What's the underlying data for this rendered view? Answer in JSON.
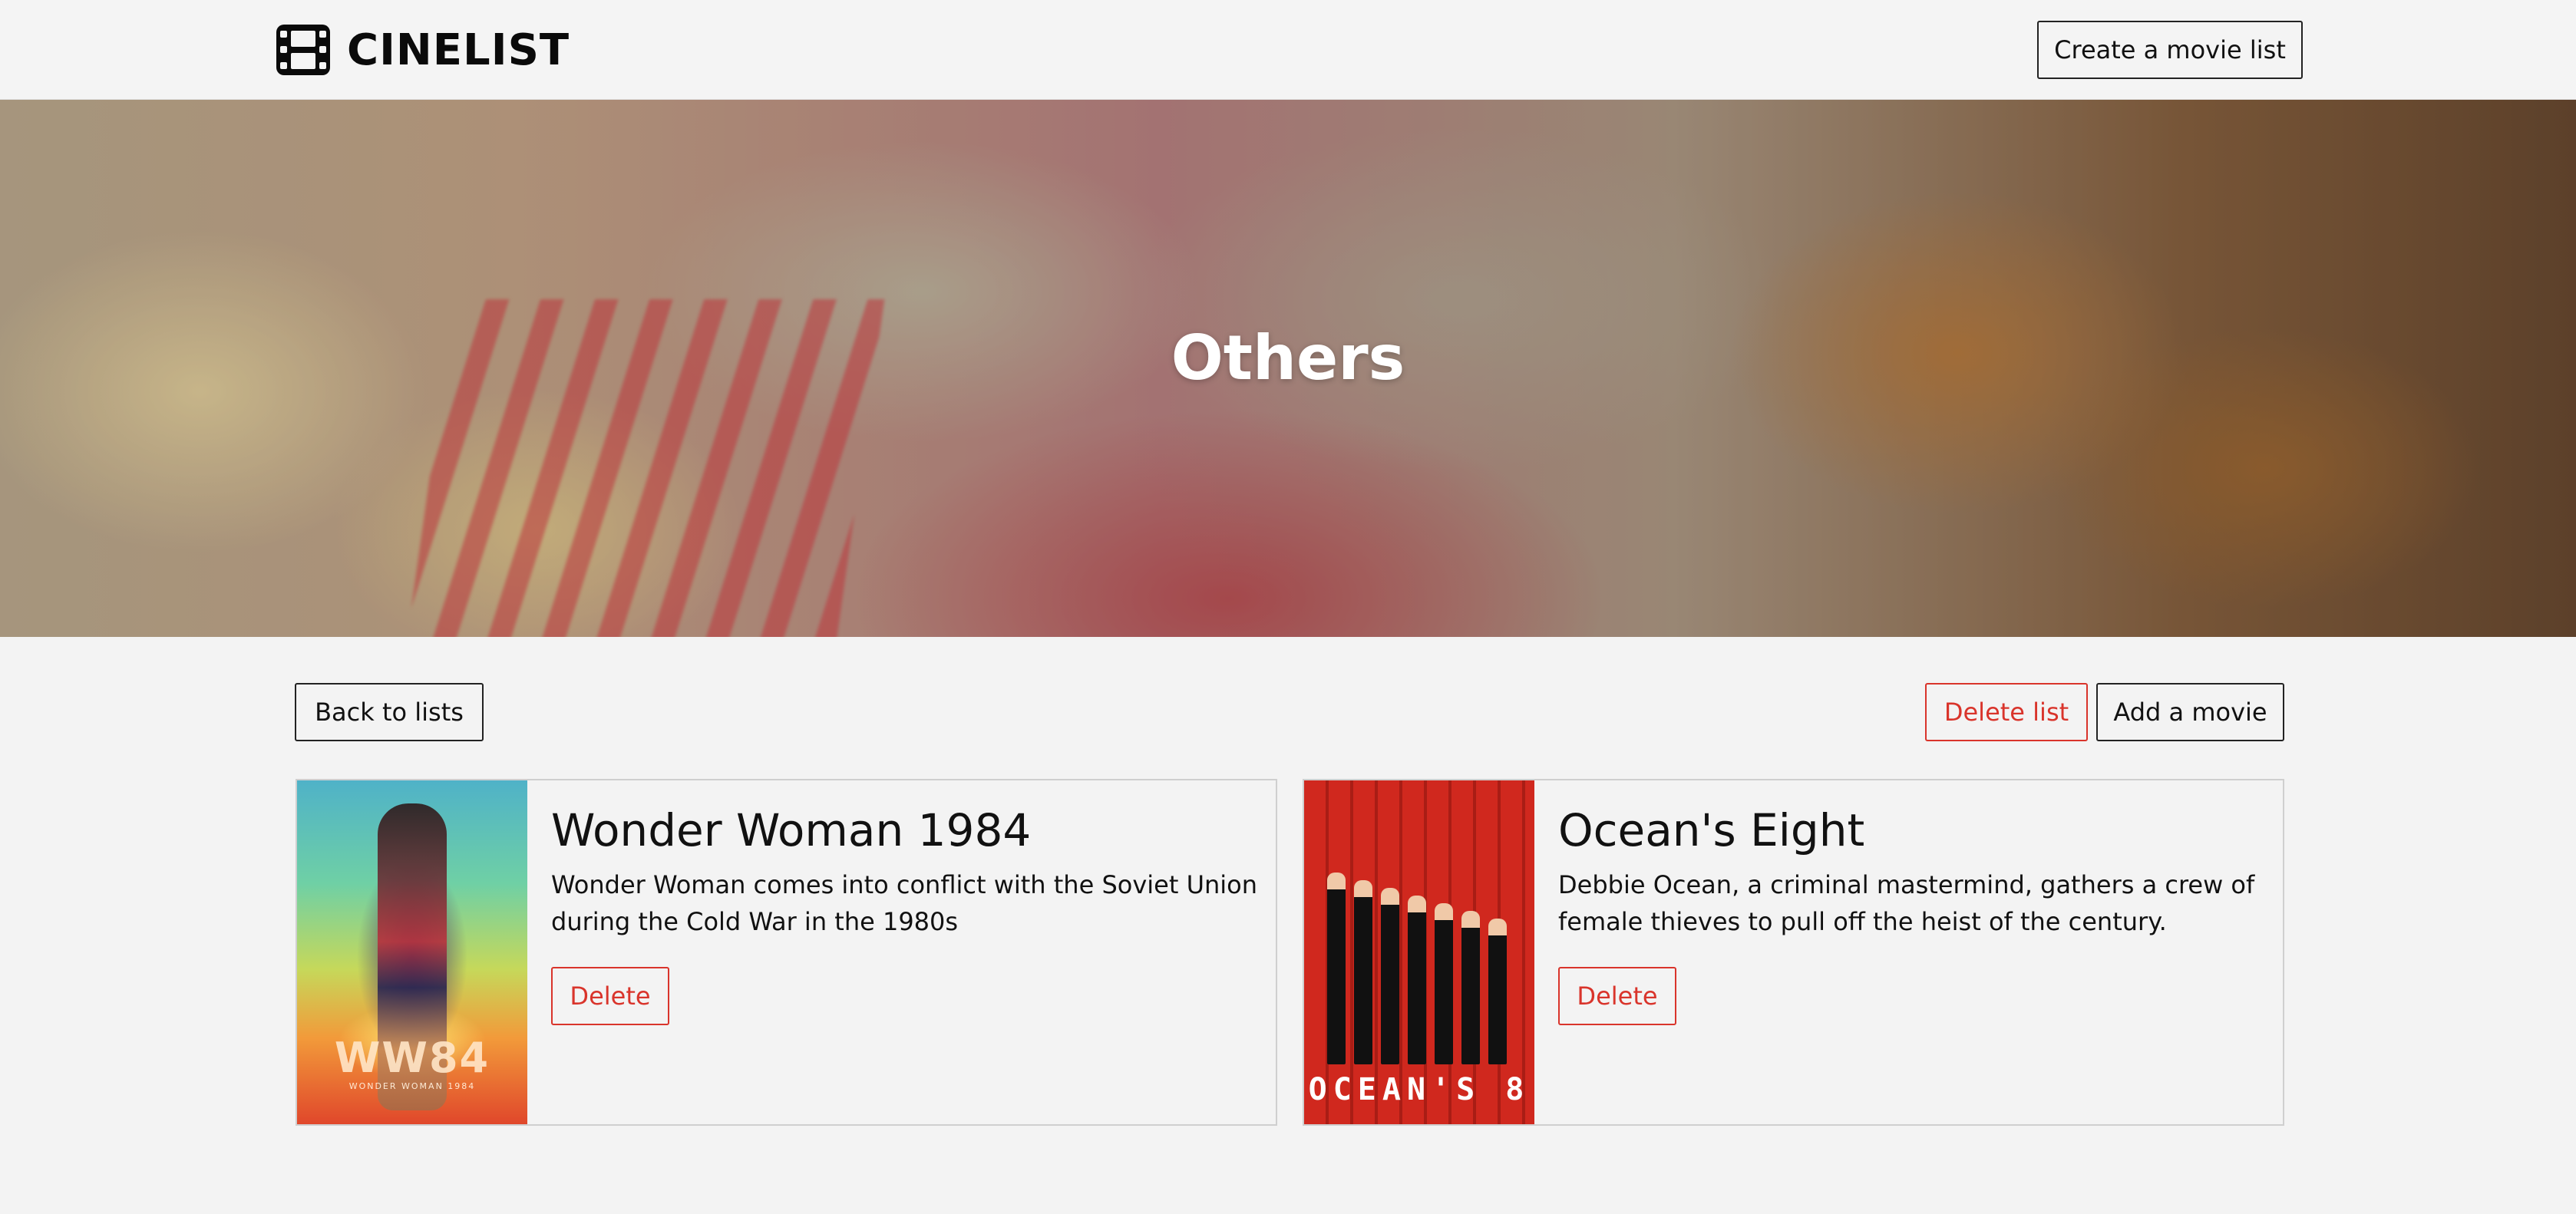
{
  "navbar": {
    "brand": "CINELIST",
    "brand_icon": "film-icon",
    "create_label": "Create a movie list"
  },
  "hero": {
    "title": "Others"
  },
  "actions": {
    "back_label": "Back to lists",
    "delete_list_label": "Delete list",
    "add_movie_label": "Add a movie"
  },
  "movies": [
    {
      "title": "Wonder Woman 1984",
      "description": "Wonder Woman comes into conflict with the Soviet Union during the Cold War in the 1980s",
      "delete_label": "Delete",
      "poster_text": "WW84",
      "poster_subtext": "WONDER WOMAN 1984"
    },
    {
      "title": "Ocean's Eight",
      "description": "Debbie Ocean, a criminal mastermind, gathers a crew of female thieves to pull off the heist of the century.",
      "delete_label": "Delete",
      "poster_text": "OCEAN'S 8"
    }
  ],
  "colors": {
    "danger": "#d9342b",
    "background": "#f3f3f3",
    "text": "#111111"
  }
}
